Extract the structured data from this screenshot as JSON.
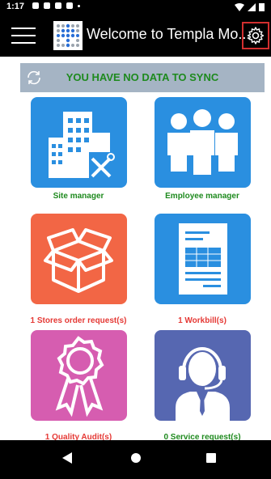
{
  "status_bar": {
    "time": "1:17"
  },
  "header": {
    "title": "Welcome to Templa Mo..."
  },
  "sync": {
    "message": "YOU HAVE NO DATA TO SYNC"
  },
  "tiles": [
    {
      "label": "Site manager",
      "color": "#2a8fe0",
      "label_color": "#1e8a1e",
      "icon": "building-icon"
    },
    {
      "label": "Employee manager",
      "color": "#2a8fe0",
      "label_color": "#1e8a1e",
      "icon": "people-icon"
    },
    {
      "label": "1 Stores order request(s)",
      "color": "#f26645",
      "label_color": "#e53935",
      "icon": "box-icon"
    },
    {
      "label": "1 Workbill(s)",
      "color": "#2a8fe0",
      "label_color": "#e53935",
      "icon": "document-icon"
    },
    {
      "label": "1 Quality Audit(s)",
      "color": "#d65db0",
      "label_color": "#e53935",
      "icon": "ribbon-icon"
    },
    {
      "label": "0 Service request(s)",
      "color": "#5667b1",
      "label_color": "#1e8a1e",
      "icon": "headset-agent-icon"
    }
  ],
  "colors": {
    "accent_red": "#d32f2f",
    "sync_bar": "#a5b4c4"
  }
}
